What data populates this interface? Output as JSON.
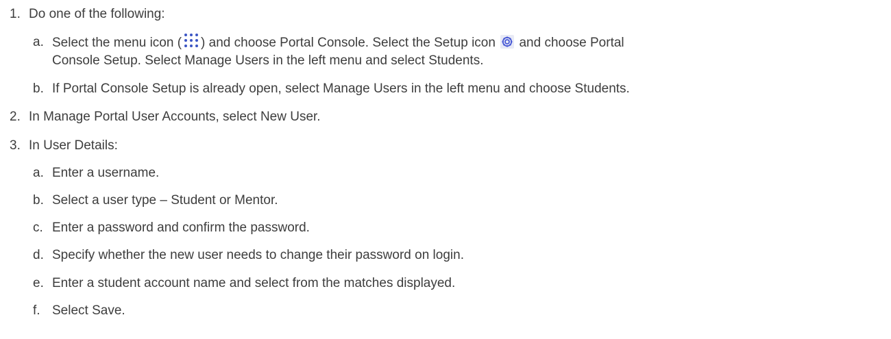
{
  "steps": [
    {
      "number": "1.",
      "text": "Do one of the following:"
    },
    {
      "number": "2.",
      "text": "In Manage Portal User Accounts, select New User."
    },
    {
      "number": "3.",
      "text": "In User Details:"
    }
  ],
  "step1_subs": {
    "a": {
      "letter": "a.",
      "part1": "Select the menu icon (",
      "part2": ") and choose Portal Console. Select the Setup icon",
      "part3": "and choose Portal",
      "line2": "Console Setup. Select Manage Users in the left menu and select Students."
    },
    "b": {
      "letter": "b.",
      "text": "If Portal Console Setup is already open, select Manage Users in the left menu and choose Students."
    }
  },
  "step3_subs": [
    {
      "letter": "a.",
      "text": "Enter a username."
    },
    {
      "letter": "b.",
      "text": "Select a user type – Student or Mentor."
    },
    {
      "letter": "c.",
      "text": "Enter a password and confirm the password."
    },
    {
      "letter": "d.",
      "text": "Specify whether the new user needs to change their password on login."
    },
    {
      "letter": "e.",
      "text": "Enter a student account name and select from the matches displayed."
    },
    {
      "letter": "f.",
      "text": "Select Save."
    }
  ],
  "icons": {
    "menu_icon": "menu-dots-icon",
    "setup_icon": "setup-gear-icon",
    "menu_icon_color": "#3b55c4",
    "setup_icon_color": "#4a5bd6"
  }
}
